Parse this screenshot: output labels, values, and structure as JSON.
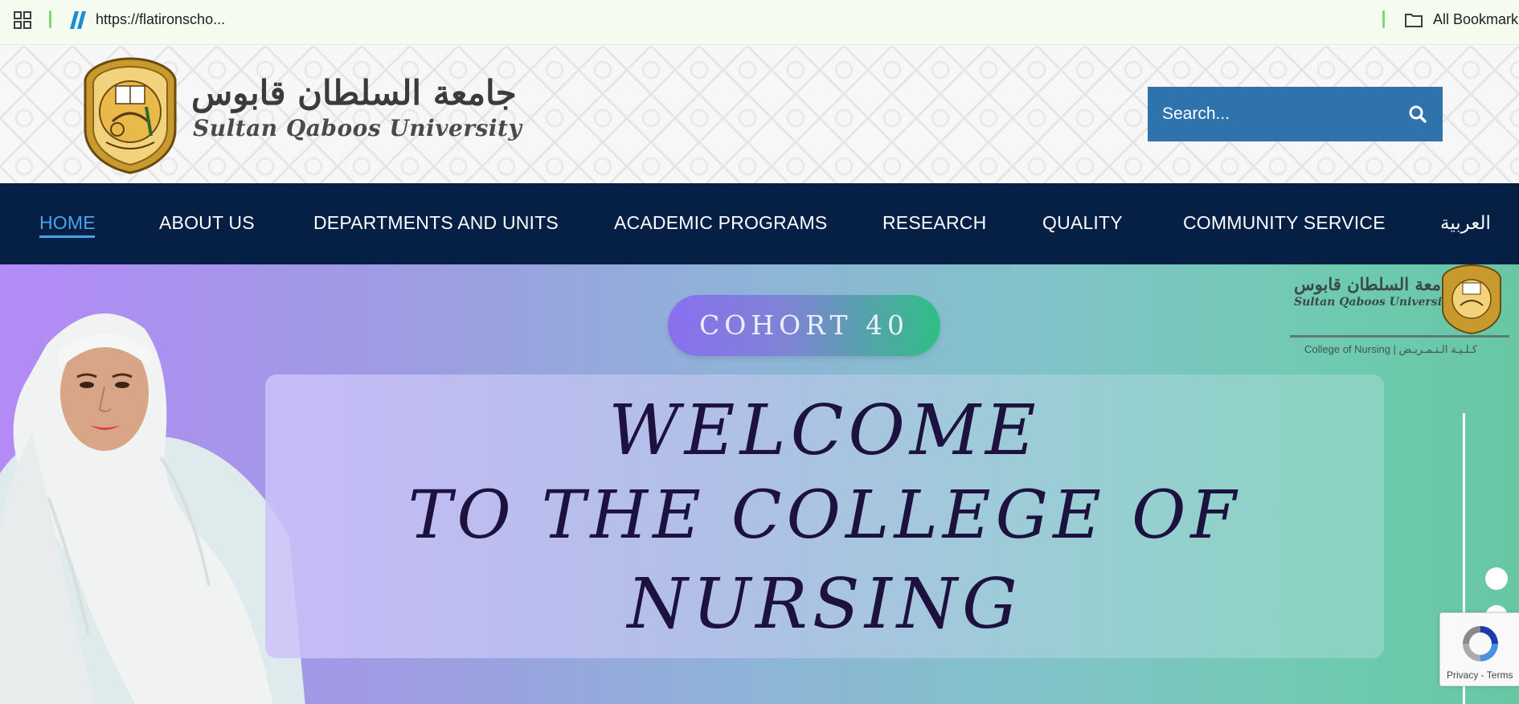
{
  "browser": {
    "url": "https://flatironscho...",
    "bookmarks_label": "All Bookmark"
  },
  "header": {
    "logo_arabic": "جامعة السلطان قابوس",
    "logo_english": "Sultan Qaboos University",
    "search_placeholder": "Search..."
  },
  "nav": {
    "items": [
      {
        "label": "HOME",
        "active": true
      },
      {
        "label": "ABOUT US"
      },
      {
        "label": "DEPARTMENTS AND UNITS"
      },
      {
        "label": "ACADEMIC PROGRAMS"
      },
      {
        "label": "RESEARCH"
      },
      {
        "label": "QUALITY"
      },
      {
        "label": "COMMUNITY SERVICE"
      },
      {
        "label": "العربية"
      }
    ]
  },
  "hero": {
    "cohort": "COHORT 40",
    "welcome_line1": "WELCOME",
    "welcome_line2": "TO THE COLLEGE OF",
    "welcome_line3": "NURSING",
    "mini_logo_arabic": "جامعة السلطان قابوس",
    "mini_logo_english": "Sultan Qaboos University",
    "college_label": "College of Nursing | كـلـيـة الـتـمـريـض"
  },
  "recaptcha": {
    "links": "Privacy - Terms"
  },
  "colors": {
    "nav_bg": "#061f44",
    "nav_active": "#4aa3ee",
    "search_bg": "#2f73ad",
    "welcome_text": "#1d1140"
  }
}
